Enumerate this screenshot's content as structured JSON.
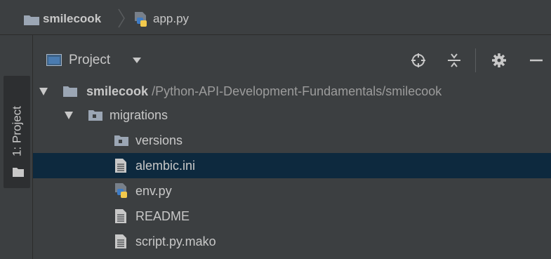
{
  "breadcrumb": {
    "root": "smilecook",
    "file": "app.py"
  },
  "side_tab": {
    "label": "1: Project"
  },
  "project_view": {
    "label": "Project"
  },
  "tree": {
    "root_name": "smilecook",
    "root_path": "/Python-API-Development-Fundamentals/smilecook",
    "migrations": "migrations",
    "versions": "versions",
    "alembic": "alembic.ini",
    "env": "env.py",
    "readme": "README",
    "script": "script.py.mako"
  },
  "colors": {
    "background": "#3c3f41",
    "selection": "#0d293e",
    "folder": "#9ba6b4",
    "python_blue": "#3f7cc4",
    "python_yellow": "#f2c94c"
  },
  "icons": [
    "folder-icon",
    "python-file-icon",
    "text-file-icon",
    "locate-icon",
    "collapse-icon",
    "gear-icon",
    "hide-icon"
  ]
}
